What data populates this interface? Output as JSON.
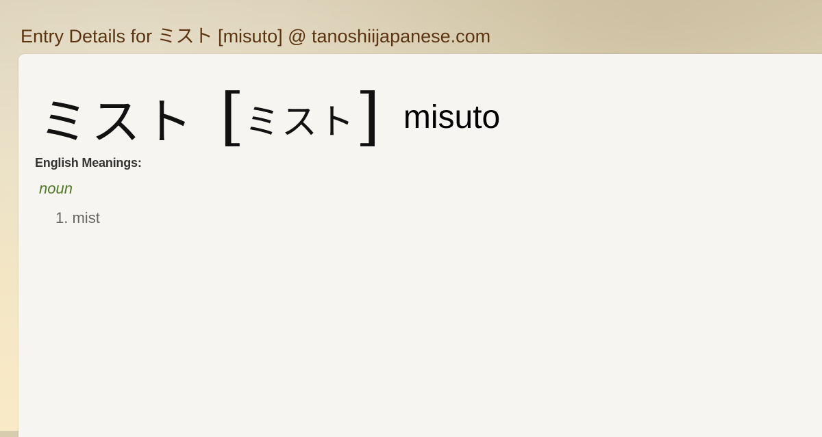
{
  "site_title": "Entry Details for ミスト [misuto] @ tanoshiijapanese.com",
  "entry": {
    "word": "ミスト",
    "bracket_open": "[",
    "reading": "ミスト",
    "bracket_close": "]",
    "romaji": "misuto"
  },
  "meanings": {
    "label": "English Meanings:",
    "part_of_speech": "noun",
    "definitions": [
      {
        "number": "1.",
        "text": "mist"
      }
    ]
  }
}
